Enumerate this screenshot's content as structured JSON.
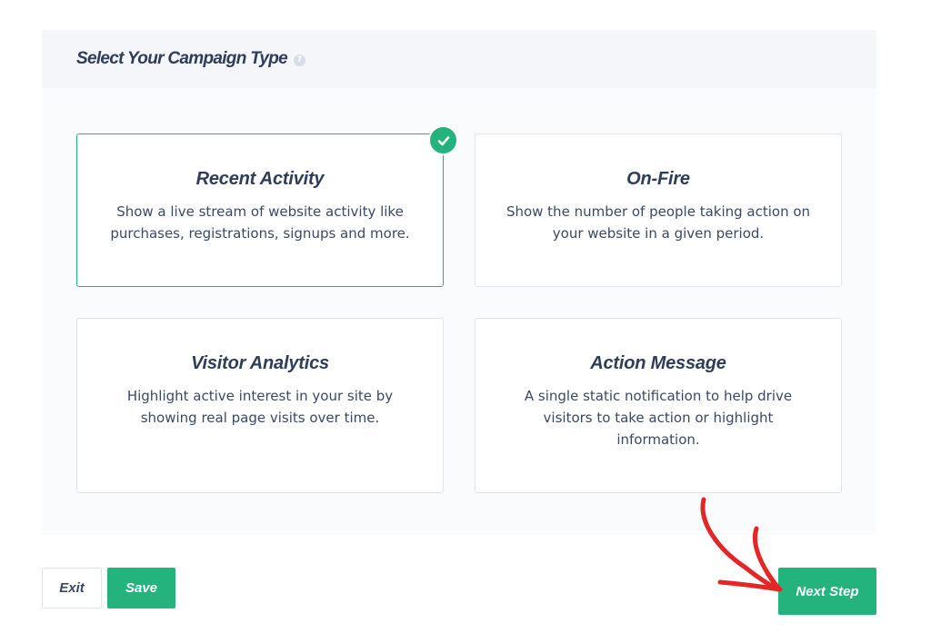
{
  "header": {
    "title": "Select Your Campaign Type",
    "help_icon": "question-mark-icon"
  },
  "campaign_types": [
    {
      "title": "Recent Activity",
      "description": "Show a live stream of website activity like purchases, registrations, signups and more.",
      "selected": true
    },
    {
      "title": "On-Fire",
      "description": "Show the number of people taking action on your website in a given period.",
      "selected": false
    },
    {
      "title": "Visitor Analytics",
      "description": "Highlight active interest in your site by showing real page visits over time.",
      "selected": false
    },
    {
      "title": "Action Message",
      "description": "A single static notification to help drive visitors to take action or highlight information.",
      "selected": false
    }
  ],
  "footer": {
    "exit_label": "Exit",
    "save_label": "Save",
    "next_label": "Next Step"
  },
  "colors": {
    "accent": "#24b37d",
    "text": "#3b4a63",
    "annotation_arrow": "#e32626"
  }
}
